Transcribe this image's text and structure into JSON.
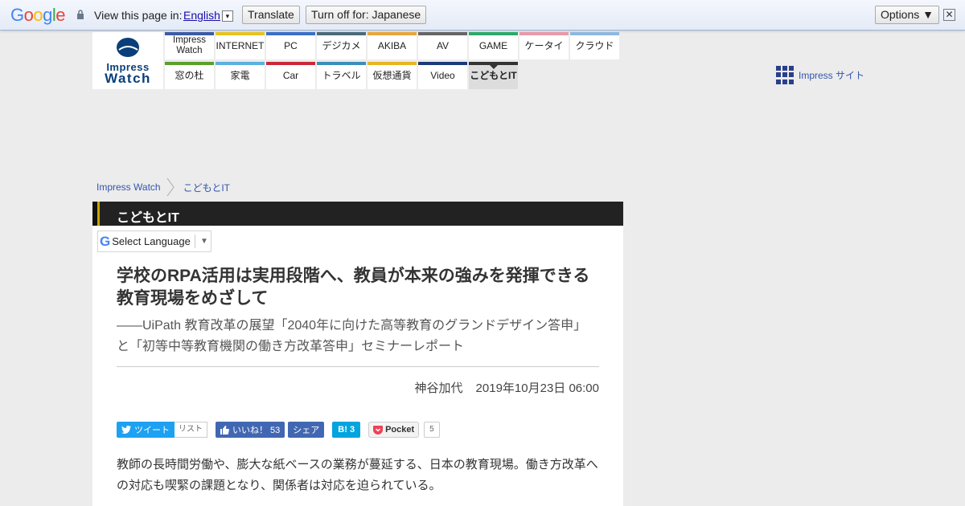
{
  "translate_bar": {
    "prompt": "View this page in:",
    "language": "English",
    "caret": "▾",
    "translate_label": "Translate",
    "turn_off_label": "Turn off for: Japanese",
    "options_label": "Options ▼",
    "close_glyph": "✕"
  },
  "logo": {
    "line1": "Impress",
    "line2": "Watch"
  },
  "nav": {
    "top": [
      {
        "label": "Impress Watch",
        "color": "#3b5ba5"
      },
      {
        "label": "INTERNET",
        "color": "#e6c422"
      },
      {
        "label": "PC",
        "color": "#3a6fc8"
      },
      {
        "label": "デジカメ",
        "color": "#4a6a7a"
      },
      {
        "label": "AKIBA",
        "color": "#e8a63a"
      },
      {
        "label": "AV",
        "color": "#666666"
      },
      {
        "label": "GAME",
        "color": "#2ea86a"
      },
      {
        "label": "ケータイ",
        "color": "#e89aa8"
      },
      {
        "label": "クラウド",
        "color": "#8fb8e0"
      }
    ],
    "bottom": [
      {
        "label": "窓の杜",
        "color": "#5aa02c"
      },
      {
        "label": "家電",
        "color": "#5ab0e0"
      },
      {
        "label": "Car",
        "color": "#c8283a"
      },
      {
        "label": "トラベル",
        "color": "#3a8fb8"
      },
      {
        "label": "仮想通貨",
        "color": "#e8b422"
      },
      {
        "label": "Video",
        "color": "#1a3a7a"
      },
      {
        "label": "こどもとIT",
        "color": "#333333"
      }
    ]
  },
  "impress_site": "Impress サイト",
  "breadcrumb": {
    "home": "Impress Watch",
    "current": "こどもとIT"
  },
  "section": {
    "title": "こどもとIT"
  },
  "select_language": "Select Language",
  "article": {
    "headline": "学校のRPA活用は実用段階へ、教員が本来の強みを発揮できる教育現場をめざして",
    "subhead": "――UiPath 教育改革の展望「2040年に向けた高等教育のグランドデザイン答申」と「初等中等教育機関の働き方改革答申」セミナーレポート",
    "author": "神谷加代",
    "date": "2019年10月23日 06:00",
    "body": "教師の長時間労働や、膨大な紙ベースの業務が蔓延する、日本の教育現場。働き方改革への対応も喫緊の課題となり、関係者は対応を迫られている。"
  },
  "share": {
    "tweet": "ツイート",
    "list": "リスト",
    "like": "いいね！ 53",
    "fb_share": "シェア",
    "hatena": "B! 3",
    "pocket": "Pocket",
    "pocket_count": "5"
  }
}
